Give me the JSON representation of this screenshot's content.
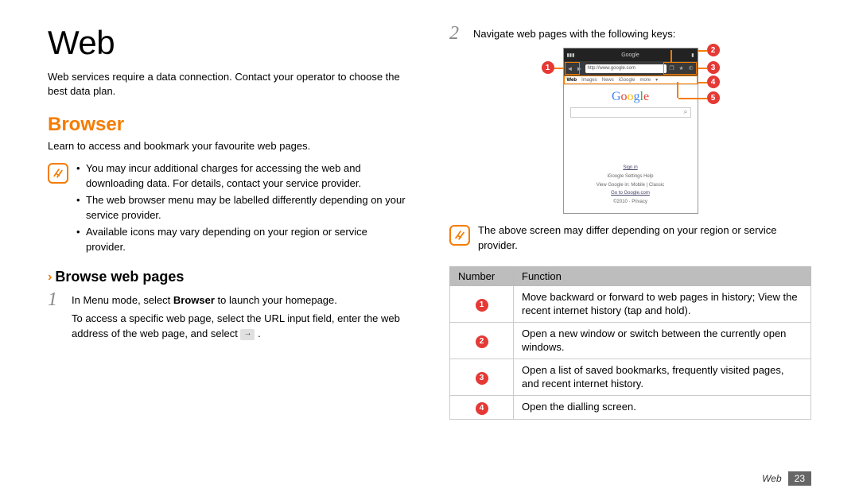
{
  "page_title": "Web",
  "intro": "Web services require a data connection. Contact your operator to choose the best data plan.",
  "section_heading": "Browser",
  "section_intro": "Learn to access and bookmark your favourite web pages.",
  "notes_left": [
    "You may incur additional charges for accessing the web and downloading data. For details, contact your service provider.",
    "The web browser menu may be labelled differently depending on your service provider.",
    "Available icons may vary depending on your region or service provider."
  ],
  "sub_heading": "Browse web pages",
  "step1_num": "1",
  "step1_a": "In Menu mode, select ",
  "step1_b": "Browser",
  "step1_c": " to launch your homepage.",
  "step1_d": "To access a specific web page, select the URL input field, enter the web address of the web page, and select ",
  "step2_num": "2",
  "step2_text": "Navigate web pages with the following keys:",
  "note_right": "The above screen may differ depending on your region or service provider.",
  "table_headers": {
    "num": "Number",
    "func": "Function"
  },
  "table_rows": [
    {
      "n": "1",
      "text": "Move backward or forward to web pages in history; View the recent internet history (tap and hold)."
    },
    {
      "n": "2",
      "text": "Open a new window or switch between the currently open windows."
    },
    {
      "n": "3",
      "text": "Open a list of saved bookmarks, frequently visited pages, and recent internet history."
    },
    {
      "n": "4",
      "text": "Open the dialling screen."
    }
  ],
  "mini": {
    "status_title": "Google",
    "url": "http://www.google.com",
    "tabs": [
      "Web",
      "Images",
      "News",
      "iGoogle",
      "more"
    ],
    "logo": "Google",
    "foot_signin": "Sign in",
    "foot_links": "iGoogle   Settings   Help",
    "foot_view": "View Google in: Mobile | Classic",
    "foot_goto": "Go to Google.com",
    "foot_copy": "©2010 · Privacy"
  },
  "foot_category": "Web",
  "foot_pagenum": "23"
}
